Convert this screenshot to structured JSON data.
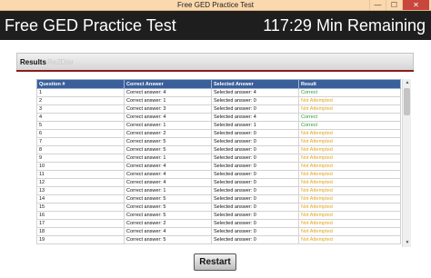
{
  "window": {
    "title": "Free GED Practice Test",
    "minimize_glyph": "—",
    "maximize_glyph": "☐",
    "close_glyph": "✕"
  },
  "header": {
    "title": "Free GED Practice Test",
    "timer": "117:29 Min Remaining"
  },
  "panel": {
    "title": "Results",
    "ghost_text": "Re2Disr"
  },
  "table": {
    "columns": [
      "Question #",
      "Correct Answer",
      "Selected Answer",
      "Result"
    ],
    "rows": [
      [
        "1",
        "Correct answer: 4",
        "Selected answer: 4",
        "Correct"
      ],
      [
        "2",
        "Correct answer: 1",
        "Selected answer: 0",
        "Not Attempted"
      ],
      [
        "3",
        "Correct answer: 3",
        "Selected answer: 0",
        "Not Attempted"
      ],
      [
        "4",
        "Correct answer: 4",
        "Selected answer: 4",
        "Correct"
      ],
      [
        "5",
        "Correct answer: 1",
        "Selected answer: 1",
        "Correct"
      ],
      [
        "6",
        "Correct answer: 2",
        "Selected answer: 0",
        "Not Attempted"
      ],
      [
        "7",
        "Correct answer: 5",
        "Selected answer: 0",
        "Not Attempted"
      ],
      [
        "8",
        "Correct answer: 5",
        "Selected answer: 0",
        "Not Attempted"
      ],
      [
        "9",
        "Correct answer: 1",
        "Selected answer: 0",
        "Not Attempted"
      ],
      [
        "10",
        "Correct answer: 4",
        "Selected answer: 0",
        "Not Attempted"
      ],
      [
        "11",
        "Correct answer: 4",
        "Selected answer: 0",
        "Not Attempted"
      ],
      [
        "12",
        "Correct answer: 4",
        "Selected answer: 0",
        "Not Attempted"
      ],
      [
        "13",
        "Correct answer: 1",
        "Selected answer: 0",
        "Not Attempted"
      ],
      [
        "14",
        "Correct answer: 5",
        "Selected answer: 0",
        "Not Attempted"
      ],
      [
        "15",
        "Correct answer: 5",
        "Selected answer: 0",
        "Not Attempted"
      ],
      [
        "16",
        "Correct answer: 5",
        "Selected answer: 0",
        "Not Attempted"
      ],
      [
        "17",
        "Correct answer: 2",
        "Selected answer: 0",
        "Not Attempted"
      ],
      [
        "18",
        "Correct answer: 4",
        "Selected answer: 0",
        "Not Attempted"
      ],
      [
        "19",
        "Correct answer: 5",
        "Selected answer: 0",
        "Not Attempted"
      ]
    ]
  },
  "scrollbar": {
    "up_glyph": "▲",
    "down_glyph": "▼"
  },
  "restart_label": "Restart",
  "colors": {
    "correct": "#2e9a2e",
    "not_attempted": "#e3a51d",
    "header_bg": "#1e1e1e",
    "table_header_bg": "#3a5f9a",
    "accent_rule": "#8b1c1c"
  }
}
